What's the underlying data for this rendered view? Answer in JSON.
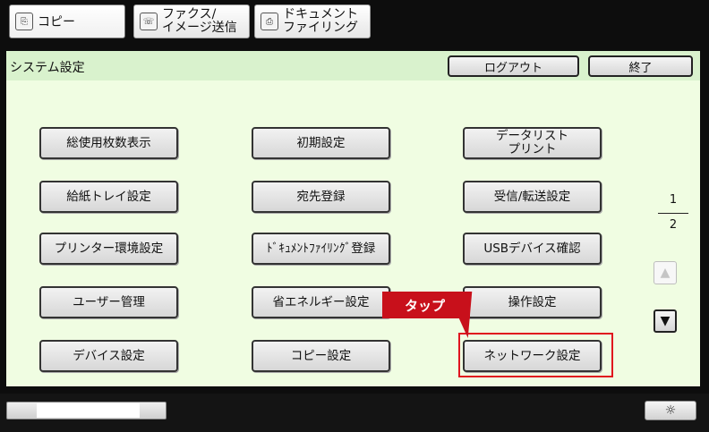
{
  "tabs": [
    {
      "label": "コピー",
      "icon": "copy-icon"
    },
    {
      "label_line1": "ファクス/",
      "label_line2": "イメージ送信",
      "icon": "fax-icon"
    },
    {
      "label_line1": "ドキュメント",
      "label_line2": "ファイリング",
      "icon": "document-filing-icon"
    }
  ],
  "header": {
    "title": "システム設定",
    "logout_label": "ログアウト",
    "exit_label": "終了"
  },
  "menu": {
    "col1": [
      "総使用枚数表示",
      "給紙トレイ設定",
      "プリンター環境設定",
      "ユーザー管理",
      "デバイス設定"
    ],
    "col2": [
      "初期設定",
      "宛先登録",
      "ﾄﾞｷｭﾒﾝﾄﾌｧｲﾘﾝｸﾞ登録",
      "省エネルギー設定",
      "コピー設定"
    ],
    "col3": [
      "データリスト\nプリント",
      "受信/転送設定",
      "USBデバイス確認",
      "操作設定",
      "ネットワーク設定"
    ]
  },
  "callout": {
    "label": "タップ",
    "color": "#c8101b"
  },
  "pager": {
    "current": "1",
    "total": "2"
  },
  "colors": {
    "title_bar": "#d9f2cd",
    "content_bg": "#f0fde2",
    "highlight": "#e0141e"
  }
}
